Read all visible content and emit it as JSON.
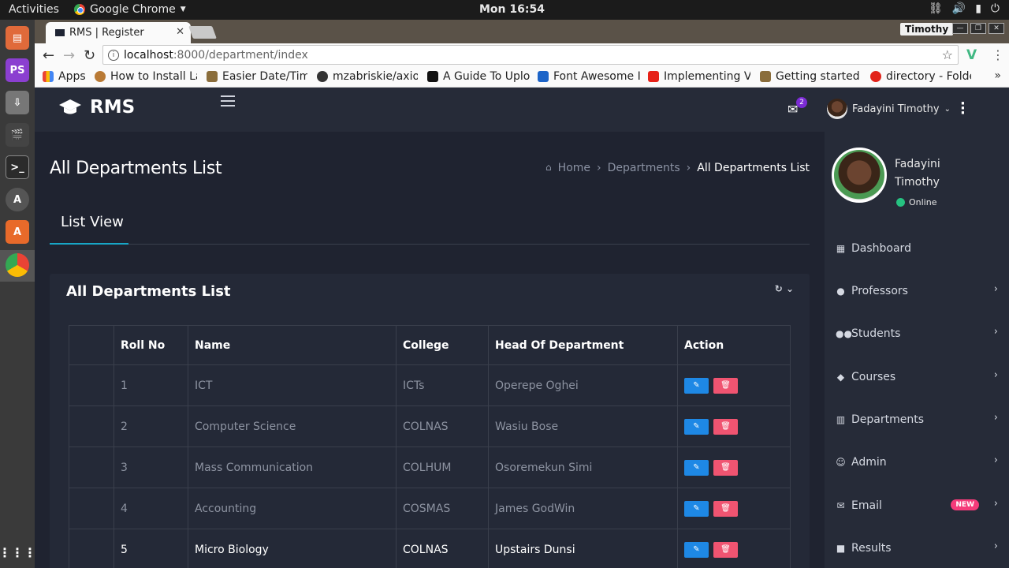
{
  "os": {
    "activities": "Activities",
    "app_menu": "Google Chrome",
    "clock": "Mon 16:54"
  },
  "browser": {
    "tab_title": "RMS | Register",
    "profile": "Timothy",
    "url_host": "localhost",
    "url_path": ":8000/department/index",
    "bookmarks": [
      {
        "label": "Apps",
        "color": "#4285f4"
      },
      {
        "label": "How to Install La",
        "color": "#b97a35"
      },
      {
        "label": "Easier Date/Time",
        "color": "#8a6d3b"
      },
      {
        "label": "mzabriskie/axios",
        "color": "#333333"
      },
      {
        "label": "A Guide To Uploa",
        "color": "#111111"
      },
      {
        "label": "Font Awesome Ic",
        "color": "#1c64c8"
      },
      {
        "label": "Implementing Vu",
        "color": "#e62117"
      },
      {
        "label": "Getting started v",
        "color": "#8a6d3b"
      },
      {
        "label": "directory - Folde",
        "color": "#e2231a"
      }
    ]
  },
  "header": {
    "brand": "RMS",
    "mail_count": "2",
    "user_name": "Fadayini Timothy"
  },
  "main": {
    "page_title": "All Departments List",
    "breadcrumb": {
      "home": "Home",
      "section": "Departments",
      "current": "All Departments List"
    },
    "tab": "List View",
    "card_title": "All Departments List",
    "table": {
      "headers": [
        "",
        "Roll No",
        "Name",
        "College",
        "Head Of Department",
        "Action"
      ],
      "rows": [
        {
          "roll": "1",
          "name": "ICT",
          "college": "ICTs",
          "head": "Operepe Oghei"
        },
        {
          "roll": "2",
          "name": "Computer Science",
          "college": "COLNAS",
          "head": "Wasiu Bose"
        },
        {
          "roll": "3",
          "name": "Mass Communication",
          "college": "COLHUM",
          "head": "Osoremekun Simi"
        },
        {
          "roll": "4",
          "name": "Accounting",
          "college": "COSMAS",
          "head": "James GodWin"
        },
        {
          "roll": "5",
          "name": "Micro Biology",
          "college": "COLNAS",
          "head": "Upstairs Dunsi"
        }
      ]
    }
  },
  "sidebar": {
    "profile_name": "Fadayini Timothy",
    "status": "Online",
    "items": [
      {
        "label": "Dashboard",
        "icon": "dashboard-icon"
      },
      {
        "label": "Professors",
        "icon": "person-icon"
      },
      {
        "label": "Students",
        "icon": "group-icon"
      },
      {
        "label": "Courses",
        "icon": "school-icon"
      },
      {
        "label": "Departments",
        "icon": "building-icon"
      },
      {
        "label": "Admin",
        "icon": "face-icon"
      },
      {
        "label": "Email",
        "icon": "mail-icon",
        "badge": "NEW"
      },
      {
        "label": "Results",
        "icon": "box-icon"
      }
    ]
  }
}
